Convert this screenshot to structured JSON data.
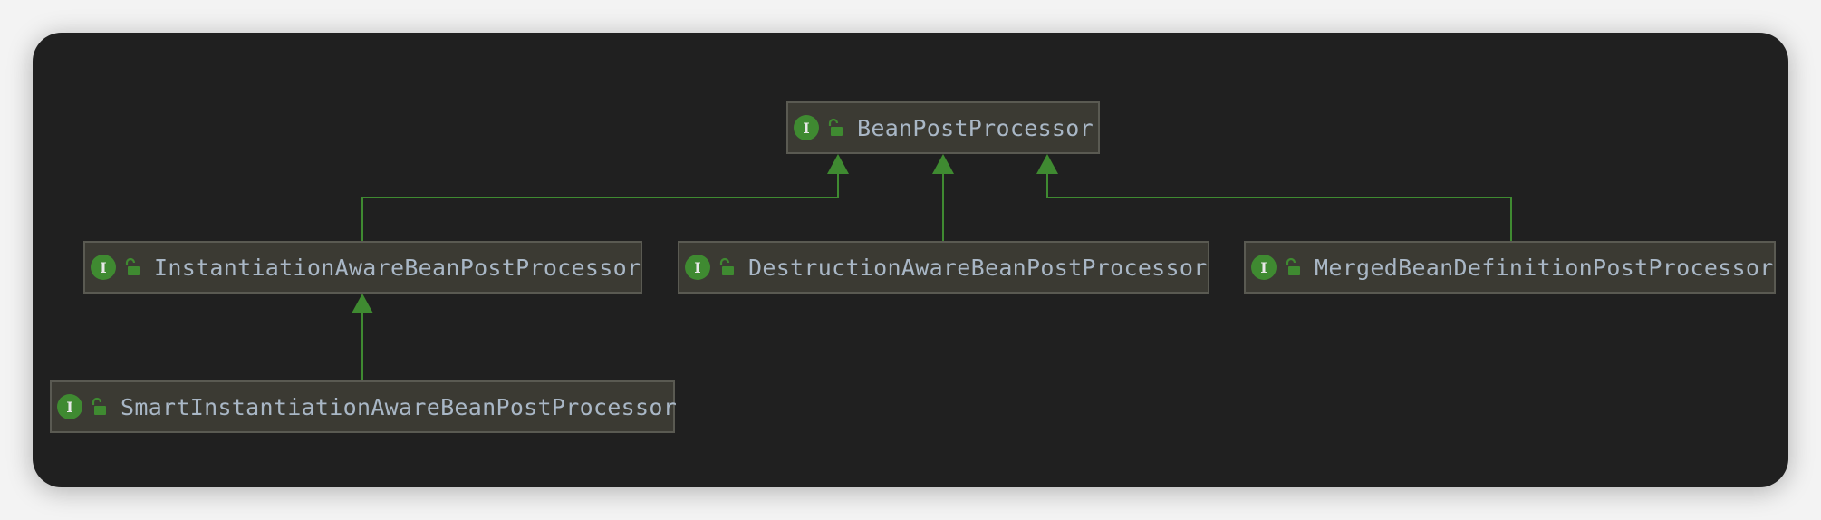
{
  "diagram": {
    "colors": {
      "background": "#202020",
      "node_fill": "#3b3a33",
      "node_border": "#5a5a52",
      "edge": "#3f8a31",
      "badge": "#3f8a31",
      "text": "#a9b7c6"
    },
    "nodes": [
      {
        "id": "bean-post-processor",
        "label": "BeanPostProcessor",
        "badge": "I",
        "icon": "open-lock-icon"
      },
      {
        "id": "instantiation-aware",
        "label": "InstantiationAwareBeanPostProcessor",
        "badge": "I",
        "icon": "open-lock-icon"
      },
      {
        "id": "destruction-aware",
        "label": "DestructionAwareBeanPostProcessor",
        "badge": "I",
        "icon": "open-lock-icon"
      },
      {
        "id": "merged-bean-definition",
        "label": "MergedBeanDefinitionPostProcessor",
        "badge": "I",
        "icon": "open-lock-icon"
      },
      {
        "id": "smart-instantiation-aware",
        "label": "SmartInstantiationAwareBeanPostProcessor",
        "badge": "I",
        "icon": "open-lock-icon"
      }
    ],
    "edges": [
      {
        "from": "instantiation-aware",
        "to": "bean-post-processor",
        "kind": "extends"
      },
      {
        "from": "destruction-aware",
        "to": "bean-post-processor",
        "kind": "extends"
      },
      {
        "from": "merged-bean-definition",
        "to": "bean-post-processor",
        "kind": "extends"
      },
      {
        "from": "smart-instantiation-aware",
        "to": "instantiation-aware",
        "kind": "extends"
      }
    ]
  }
}
